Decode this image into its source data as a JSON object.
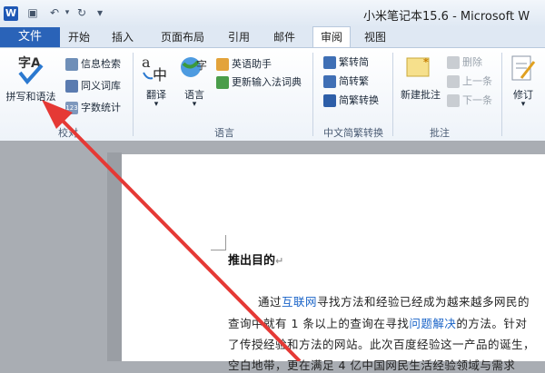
{
  "titlebar": {
    "title": "小米笔记本15.6 - Microsoft W",
    "app_icon": "W"
  },
  "tabs": {
    "file": "文件",
    "items": [
      "开始",
      "插入",
      "页面布局",
      "引用",
      "邮件",
      "审阅",
      "视图"
    ],
    "active": "审阅"
  },
  "ribbon": {
    "proofing": {
      "spell_check": "拼写和语法",
      "research": "信息检索",
      "thesaurus": "同义词库",
      "word_count": "字数统计",
      "group_label": "校对"
    },
    "language": {
      "translate": "翻译",
      "language": "语言",
      "english_assistant": "英语助手",
      "update_ime": "更新输入法词典",
      "group_label": "语言"
    },
    "chinese_conversion": {
      "to_simplified": "繁转简",
      "to_traditional": "简转繁",
      "conversion": "简繁转换",
      "group_label": "中文简繁转换"
    },
    "comments": {
      "new_comment": "新建批注",
      "delete": "删除",
      "previous": "上一条",
      "next": "下一条",
      "group_label": "批注"
    },
    "tracking": {
      "track_changes": "修订"
    }
  },
  "document": {
    "heading": "推出目的",
    "para_line1_a": "通过",
    "para_line1_link1": "互联网",
    "para_line1_b": "寻找方法和经验已经成为越来越多网民的",
    "para_line2_a": "查询中就有 1 条以上的查询在寻找",
    "para_line2_link": "问题解决",
    "para_line2_b": "的方法。针对",
    "para_line3": "了传授经验和方法的网站。此次百度经验这一产品的诞生，",
    "para_line4": "空白地带，更在满足 4 亿中国网民生活经验领域与需求"
  },
  "colors": {
    "file_tab": "#2a63b8",
    "arrow": "#e53935",
    "link": "#1a64c8"
  }
}
